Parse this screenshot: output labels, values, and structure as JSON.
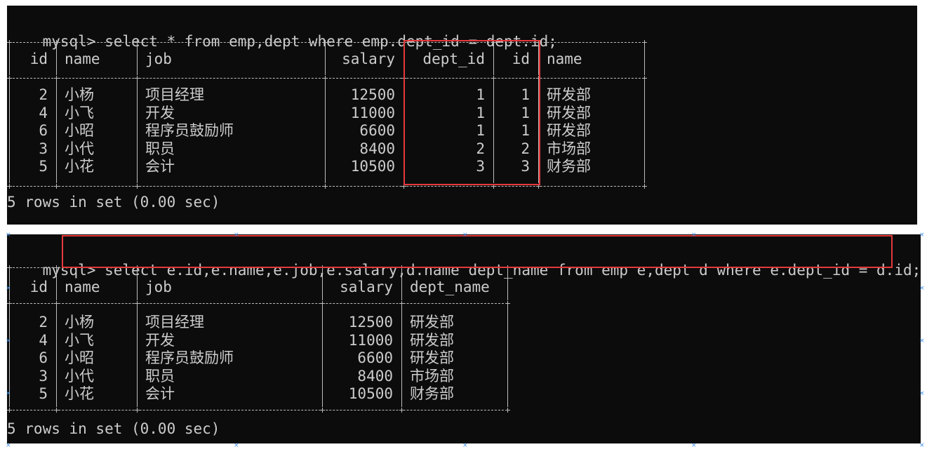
{
  "prompt": "mysql",
  "query1": {
    "command": "select * from emp,dept where emp.dept_id = dept.id;",
    "columns": [
      "id",
      "name",
      "job",
      "salary",
      "dept_id",
      "id",
      "name"
    ],
    "rows": [
      [
        "2",
        "小杨",
        "项目经理",
        "12500",
        "1",
        "1",
        "研发部"
      ],
      [
        "4",
        "小飞",
        "开发",
        "11000",
        "1",
        "1",
        "研发部"
      ],
      [
        "6",
        "小昭",
        "程序员鼓励师",
        "6600",
        "1",
        "1",
        "研发部"
      ],
      [
        "3",
        "小代",
        "职员",
        "8400",
        "2",
        "2",
        "市场部"
      ],
      [
        "5",
        "小花",
        "会计",
        "10500",
        "3",
        "3",
        "财务部"
      ]
    ],
    "footer": "5 rows in set (0.00 sec)"
  },
  "query2": {
    "command": "select e.id,e.name,e.job,e.salary,d.name dept_name from emp e,dept d where e.dept_id = d.id;",
    "columns": [
      "id",
      "name",
      "job",
      "salary",
      "dept_name"
    ],
    "rows": [
      [
        "2",
        "小杨",
        "项目经理",
        "12500",
        "研发部"
      ],
      [
        "4",
        "小飞",
        "开发",
        "11000",
        "研发部"
      ],
      [
        "6",
        "小昭",
        "程序员鼓励师",
        "6600",
        "研发部"
      ],
      [
        "3",
        "小代",
        "职员",
        "8400",
        "市场部"
      ],
      [
        "5",
        "小花",
        "会计",
        "10500",
        "财务部"
      ]
    ],
    "footer": "5 rows in set (0.00 sec)"
  },
  "colors": {
    "terminal_bg": "#0c0c0c",
    "terminal_fg": "#cccccc",
    "border": "#bdbdbd",
    "highlight": "#e5393c",
    "handle": "#3a8ee6"
  }
}
